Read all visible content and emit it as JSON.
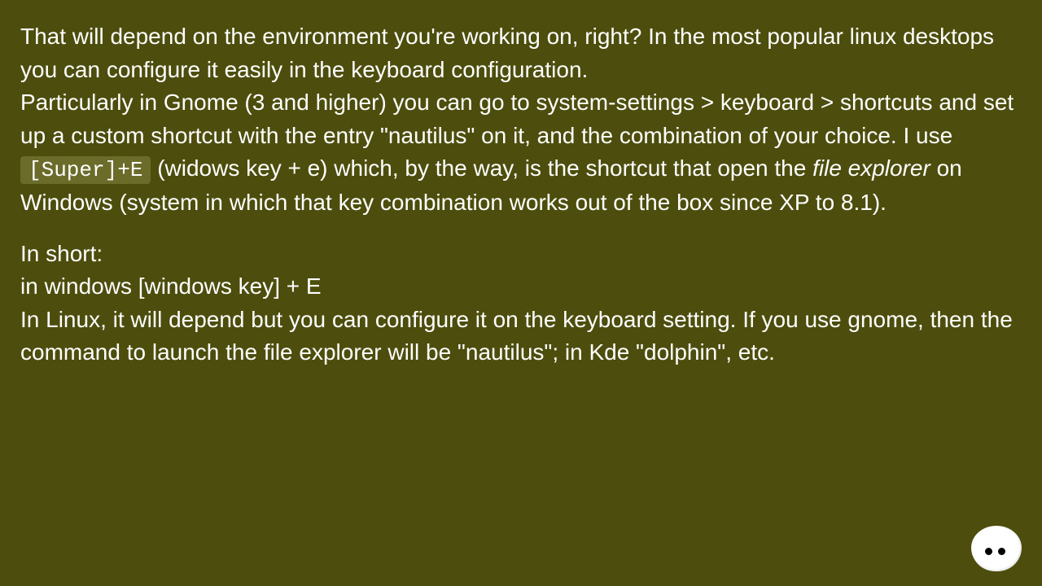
{
  "paragraphs": {
    "p1_a": "That will depend on the environment you're working on, right? In the most popular linux desktops you can configure it easily in the keyboard configuration.",
    "p1_b": "Particularly in Gnome (3 and higher) you can go to system-settings > keyboard > shortcuts and set up a custom shortcut with the entry \"nautilus\" on it, and the combination of your choice. I use ",
    "p1_code": "[Super]+E",
    "p1_c": " (widows key + e) which, by the way, is the shortcut that open the ",
    "p1_italic": "file explorer",
    "p1_d": " on Windows (system in which that key combination works out of the box since XP to 8.1).",
    "p2_a": "In short:",
    "p2_b": "in windows [windows key] + E",
    "p2_c": "In Linux, it will depend but you can configure it on the keyboard setting. If you use gnome, then the command to launch the file explorer will be \"nautilus\"; in Kde \"dolphin\", etc."
  }
}
